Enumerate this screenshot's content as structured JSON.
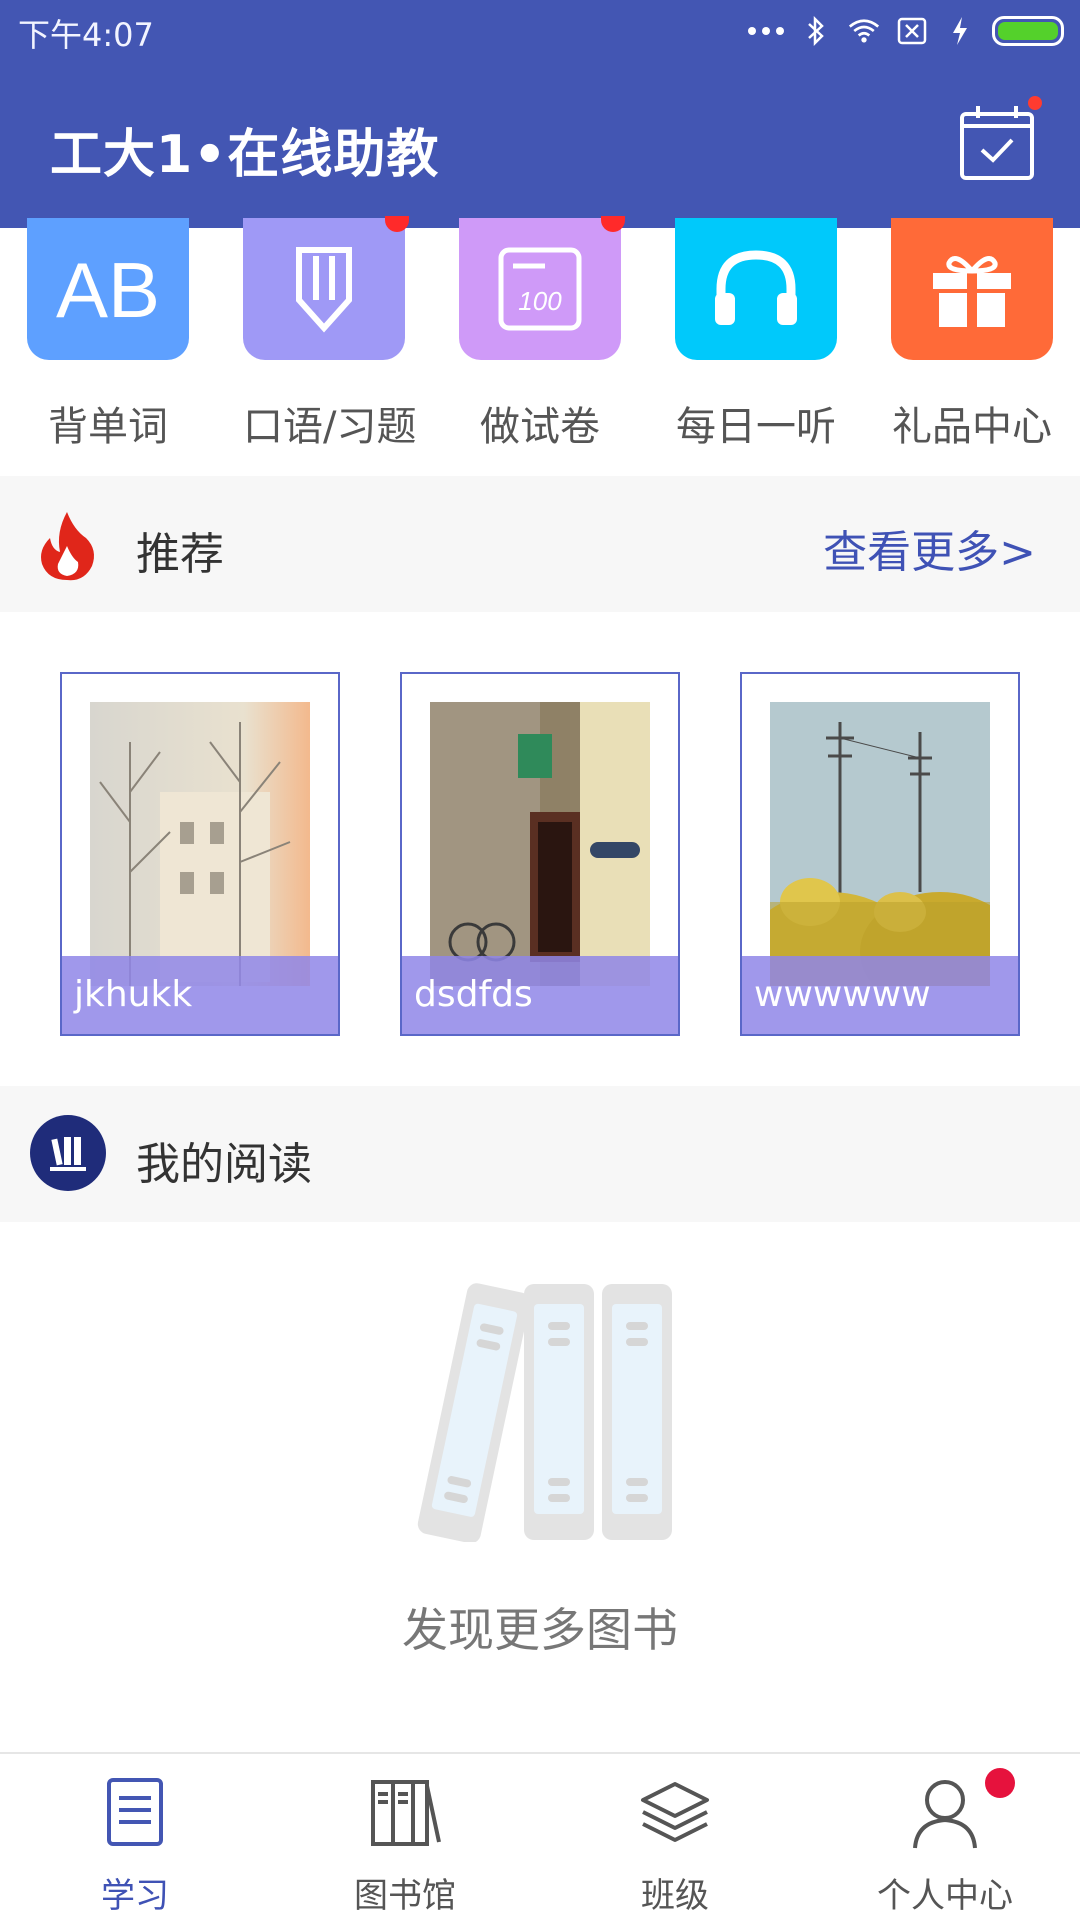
{
  "status": {
    "time": "下午4:07"
  },
  "app": {
    "title": "工大1•在线助教"
  },
  "feature_icons": [
    {
      "label": "背单词",
      "icon": "ab-icon",
      "color": "#5ea0ff"
    },
    {
      "label": "口语/习题",
      "icon": "pencil-icon",
      "color": "#9f99f6"
    },
    {
      "label": "做试卷",
      "icon": "exam-paper-icon",
      "color": "#cf9af8"
    },
    {
      "label": "每日一听",
      "icon": "headphones-icon",
      "color": "#00c9fb"
    },
    {
      "label": "礼品中心",
      "icon": "gift-icon",
      "color": "#ff6a38"
    }
  ],
  "recommend": {
    "title": "推荐",
    "more": "查看更多>",
    "items": [
      {
        "caption": "jkhukk"
      },
      {
        "caption": "dsdfds"
      },
      {
        "caption": "wwwwww"
      }
    ]
  },
  "reading": {
    "title": "我的阅读",
    "empty_text": "发现更多图书"
  },
  "bottom_nav": [
    {
      "label": "学习",
      "icon": "study-list-icon",
      "active": true
    },
    {
      "label": "图书馆",
      "icon": "library-books-icon",
      "active": false
    },
    {
      "label": "班级",
      "icon": "layers-icon",
      "active": false
    },
    {
      "label": "个人中心",
      "icon": "person-icon",
      "active": false
    }
  ],
  "colors": {
    "primary": "#4356b3",
    "accent_link": "#3f52b5",
    "badge": "#ff2a2a"
  }
}
